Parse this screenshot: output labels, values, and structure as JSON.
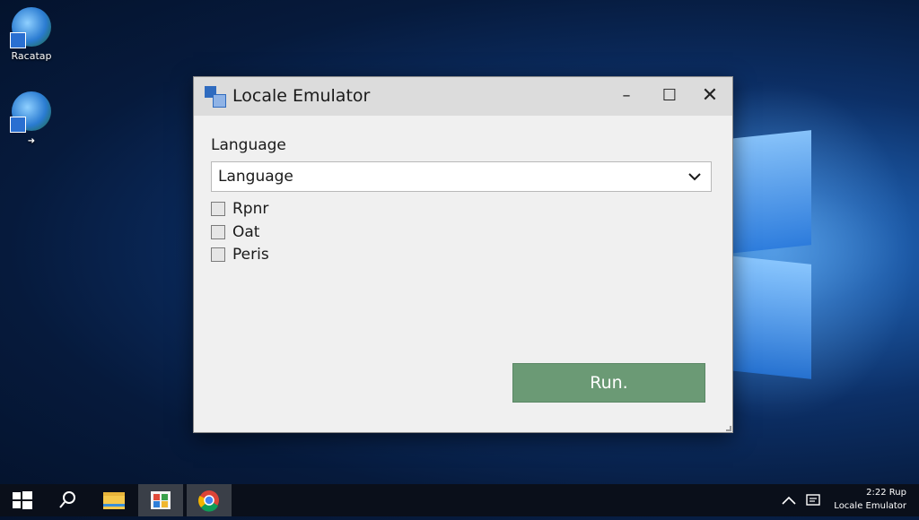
{
  "desktop": {
    "icons": [
      {
        "label": "Racatap"
      },
      {
        "label": ""
      }
    ]
  },
  "window": {
    "title": "Locale Emulator",
    "controls": {
      "minimize": "–",
      "maximize": "☐",
      "close": "✕"
    },
    "language_label": "Language",
    "language_select": {
      "selected": "Language"
    },
    "checkboxes": [
      {
        "label": "Rpnr",
        "checked": false
      },
      {
        "label": "Oat",
        "checked": false
      },
      {
        "label": "Peris",
        "checked": false
      }
    ],
    "run_button": "Run."
  },
  "taskbar": {
    "items": [
      "start",
      "search",
      "file-explorer",
      "app",
      "chrome"
    ],
    "tray": {
      "time": "2:22 Rup",
      "app_name": "Locale Emulator"
    }
  },
  "colors": {
    "run_button": "#6b9a75",
    "titlebar": "#dcdcdc",
    "taskbar": "#0a0f1a"
  }
}
